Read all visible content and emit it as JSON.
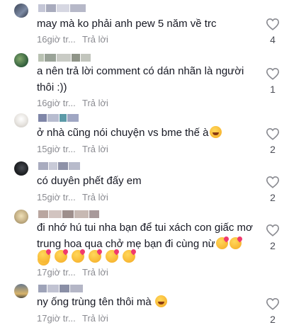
{
  "reply_label": "Trả lời",
  "comments": [
    {
      "text": "may mà ko phải anh pew 5 năm về trc",
      "time": "16giờ tr...",
      "likes": "4",
      "avatar_colors": [
        "#3a4356",
        "#7c8aa3"
      ],
      "name_blocks": [
        "#c4c6d6",
        "#a8abbd",
        "#d6d7e2",
        "#b6b8c8"
      ]
    },
    {
      "text": "a nên trả lời comment có dán nhãn là người\nthôi :))",
      "time": "16giờ tr...",
      "likes": "1",
      "avatar_colors": [
        "#2f5d3b",
        "#83a86d"
      ],
      "name_blocks": [
        "#b9c2b3",
        "#9aa398",
        "#c9cbc5",
        "#8f9488",
        "#c2c5bd"
      ]
    },
    {
      "text": "ở nhà cũng nói chuyện vs bme thế à",
      "time": "15giờ tr...",
      "likes": "2",
      "avatar_colors": [
        "#e9e6e2",
        "#c9c3bd"
      ],
      "name_blocks": [
        "#7f86a8",
        "#b7bccf",
        "#5c9aa8",
        "#9fa6c3"
      ]
    },
    {
      "text": "có duyên phết đấy em",
      "time": "15giờ tr...",
      "likes": "2",
      "avatar_colors": [
        "#1d1f22",
        "#4a4e55"
      ],
      "name_blocks": [
        "#a9acbf",
        "#c8cad7",
        "#8e92a8",
        "#b8bbcb"
      ]
    },
    {
      "text": "đi nhớ hú tui nha bạn để tui xách con giấc mơ\ntrung hoa qua chở mẹ bạn đi cùng nừ",
      "time": "17giờ tr...",
      "likes": "2",
      "avatar_colors": [
        "#c9b58a",
        "#8d7a55"
      ],
      "name_blocks": [
        "#b9a6a0",
        "#d2c4c0",
        "#9e8f8c",
        "#c7b9b3",
        "#a8999a"
      ]
    },
    {
      "text": "ny ống trùng tên thôi mà",
      "time": "17giờ tr...",
      "likes": "2",
      "avatar_colors": [
        "#6a7a8c",
        "#d9b46a"
      ],
      "name_blocks": [
        "#9ea3b8",
        "#c1c3d2",
        "#8a8fa6",
        "#b4b6c6"
      ]
    }
  ]
}
